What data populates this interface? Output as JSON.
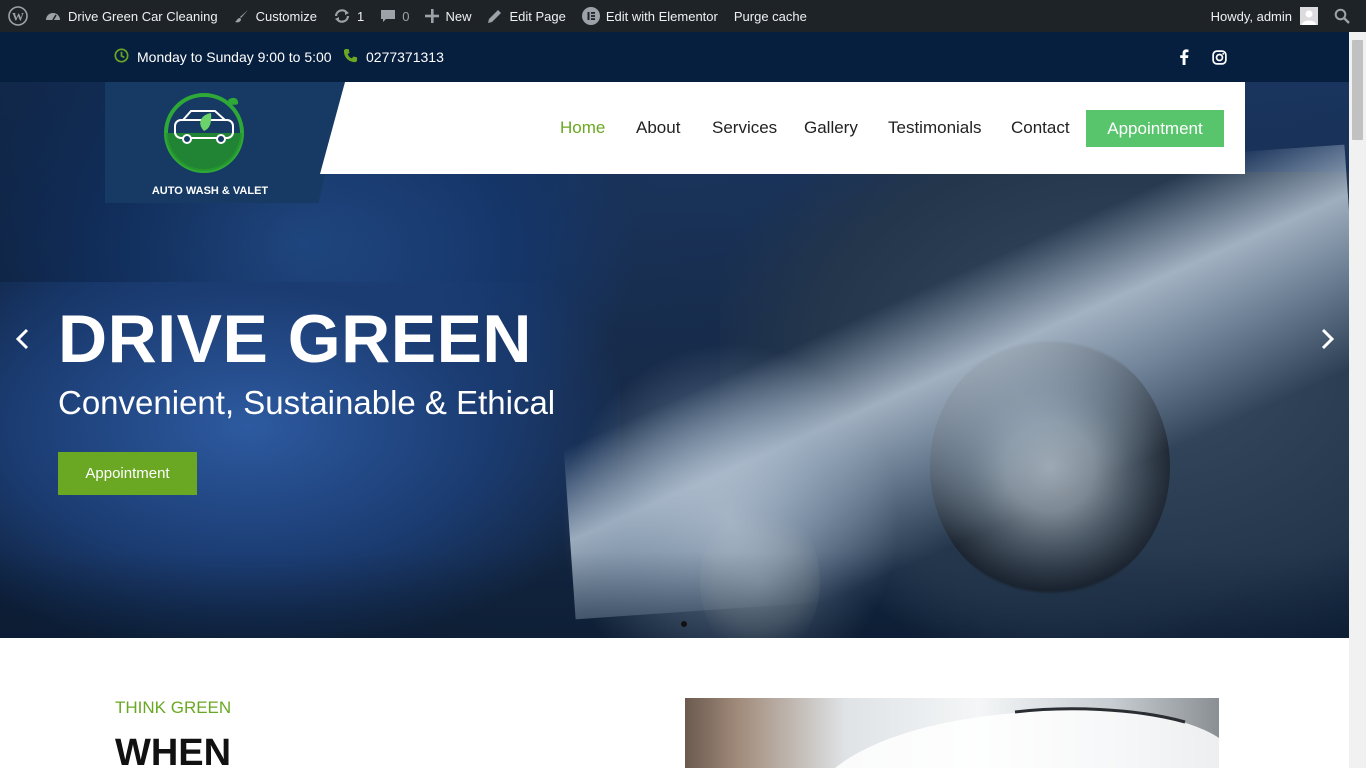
{
  "admin_bar": {
    "site_name": "Drive Green Car Cleaning",
    "customize": "Customize",
    "updates_count": "1",
    "comments_count": "0",
    "new": "New",
    "edit_page": "Edit Page",
    "edit_elementor": "Edit with Elementor",
    "purge_cache": "Purge cache",
    "howdy": "Howdy, admin"
  },
  "top_bar": {
    "hours": "Monday to Sunday 9:00 to 5:00",
    "phone": "0277371313",
    "social": [
      "facebook-icon",
      "instagram-icon"
    ]
  },
  "logo": {
    "text": "AUTO WASH & VALET"
  },
  "nav": {
    "items": [
      "Home",
      "About",
      "Services",
      "Gallery",
      "Testimonials",
      "Contact"
    ],
    "active": "Home",
    "cta": "Appointment"
  },
  "hero": {
    "title": "DRIVE GREEN",
    "subtitle": "Convenient, Sustainable & Ethical",
    "button": "Appointment"
  },
  "section": {
    "kicker": "THINK GREEN",
    "heading": "WHEN"
  },
  "colors": {
    "admin_bar": "#1d2327",
    "top_bar": "#071f3f",
    "accent_green": "#6aa823",
    "nav_cta": "#58c46b",
    "logo_bg": "#163a63"
  }
}
